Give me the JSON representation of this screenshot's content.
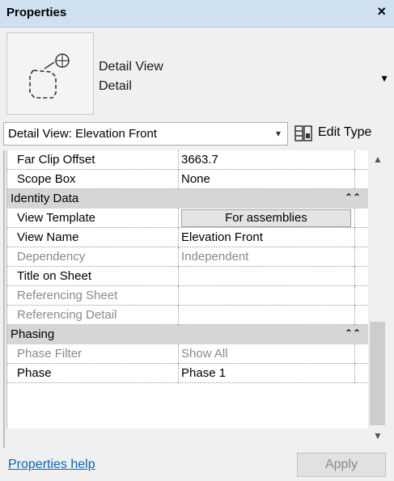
{
  "window": {
    "title": "Properties",
    "close": "×"
  },
  "type": {
    "family": "Detail View",
    "name": "Detail"
  },
  "selector": {
    "value": "Detail View: Elevation Front",
    "edit_type": "Edit Type"
  },
  "rows": [
    {
      "kind": "prop",
      "name": "Far Clip Offset",
      "value": "3663.7"
    },
    {
      "kind": "prop",
      "name": "Scope Box",
      "value": "None"
    },
    {
      "kind": "group",
      "name": "Identity Data",
      "caret": "⌃⌃"
    },
    {
      "kind": "button",
      "name": "View Template",
      "value": "For assemblies"
    },
    {
      "kind": "prop",
      "name": "View Name",
      "value": "Elevation Front"
    },
    {
      "kind": "dim",
      "name": "Dependency",
      "value": "Independent"
    },
    {
      "kind": "prop",
      "name": "Title on Sheet",
      "value": ""
    },
    {
      "kind": "dim",
      "name": "Referencing Sheet",
      "value": ""
    },
    {
      "kind": "dim",
      "name": "Referencing Detail",
      "value": ""
    },
    {
      "kind": "group",
      "name": "Phasing",
      "caret": "⌃⌃"
    },
    {
      "kind": "dim",
      "name": "Phase Filter",
      "value": "Show All"
    },
    {
      "kind": "prop",
      "name": "Phase",
      "value": "Phase 1"
    }
  ],
  "footer": {
    "help": "Properties help",
    "apply": "Apply"
  },
  "icons": {
    "view": "detail-callout-icon",
    "edit_type": "edit-type-icon"
  }
}
